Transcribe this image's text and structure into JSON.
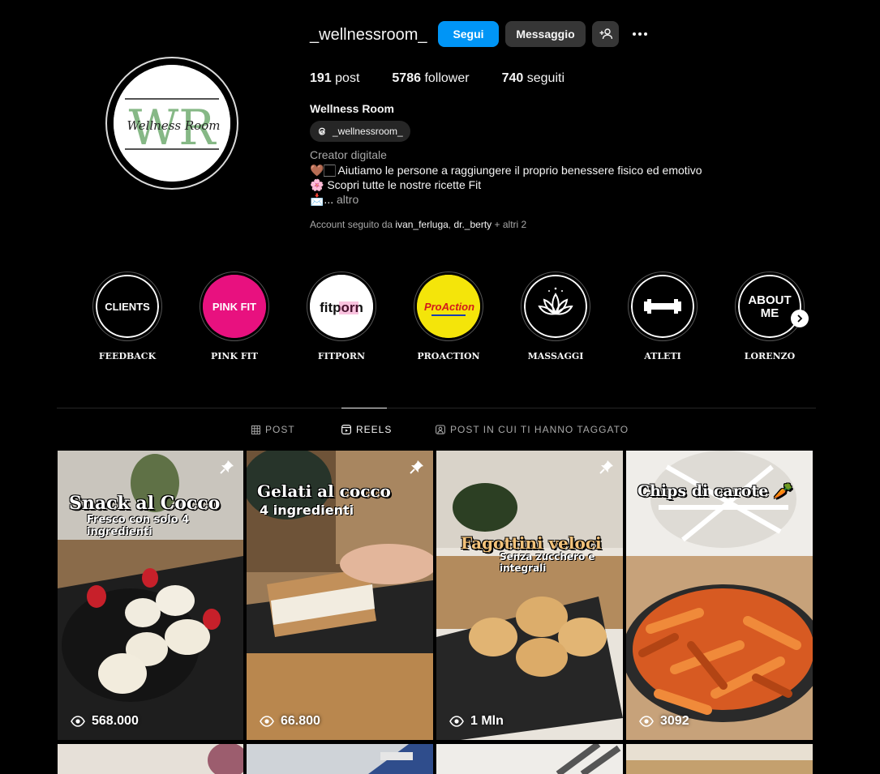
{
  "profile": {
    "username": "_wellnessroom_",
    "follow_label": "Segui",
    "message_label": "Messaggio",
    "posts_count": "191",
    "posts_label": "post",
    "followers_count": "5786",
    "followers_label": "follower",
    "following_count": "740",
    "following_label": "seguiti",
    "full_name": "Wellness Room",
    "threads_handle": "_wellnessroom_",
    "category": "Creator digitale",
    "bio_line1": "🤎🏻 Aiutiamo le persone a raggiungere il proprio benessere fisico ed emotivo",
    "bio_line2": "🌸 Scopri tutte le nostre ricette Fit",
    "bio_line3_prefix": "📩... ",
    "bio_more": "altro",
    "followed_by_prefix": "Account seguito da ",
    "followed_by_user1": "ivan_ferluga",
    "followed_by_sep": ", ",
    "followed_by_user2": "dr._berty",
    "followed_by_suffix": " + altri 2",
    "avatar_text": "Wellness Room",
    "avatar_letters": "WR"
  },
  "highlights": [
    {
      "label": "FEEDBACK",
      "cover_text": "CLIENTS"
    },
    {
      "label": "PINK FIT",
      "cover_text": "PINK FIT"
    },
    {
      "label": "FITPORN",
      "cover_text": "fitporn"
    },
    {
      "label": "PROACTION",
      "cover_text": "ProAction"
    },
    {
      "label": "MASSAGGI",
      "cover_text": ""
    },
    {
      "label": "ATLETI",
      "cover_text": ""
    },
    {
      "label": "LORENZO",
      "cover_text": "ABOUT ME"
    }
  ],
  "tabs": [
    {
      "label": "POST",
      "icon": "grid-icon",
      "active": false
    },
    {
      "label": "REELS",
      "icon": "reels-icon",
      "active": true
    },
    {
      "label": "POST IN CUI TI HANNO TAGGATO",
      "icon": "tagged-icon",
      "active": false
    }
  ],
  "reels": [
    {
      "title": "Snack al Cocco",
      "subtitle": "Fresco con solo 4 ingredienti",
      "views": "568.000",
      "pinned": true
    },
    {
      "title": "Gelati al cocco",
      "subtitle": "4 ingredienti",
      "views": "66.800",
      "pinned": true
    },
    {
      "title": "Fagottini veloci",
      "subtitle": "Senza zucchero e integrali",
      "views": "1 Mln",
      "pinned": true
    },
    {
      "title": "Chips di carote 🥕",
      "subtitle": "",
      "views": "3092",
      "pinned": false
    }
  ],
  "colors": {
    "accent": "#0095f6",
    "background": "#000000",
    "button_dark": "#363636",
    "pink_fit": "#e8117f",
    "proaction_yellow": "#f4e50a"
  }
}
